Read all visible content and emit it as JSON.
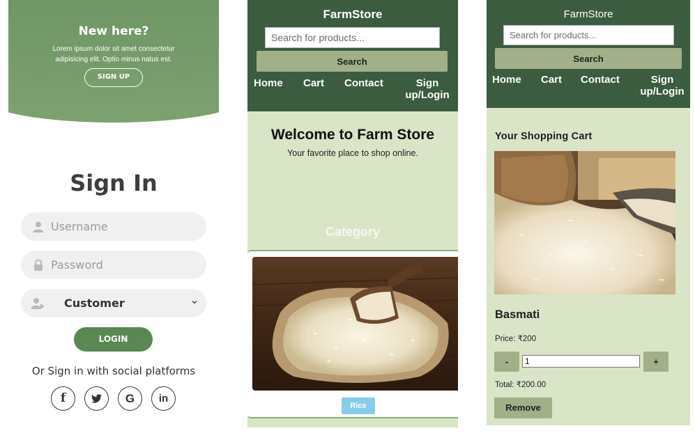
{
  "signin": {
    "banner_title": "New here?",
    "banner_text": "Lorem ipsum dolor sit amet consectetur adipisicing elit. Optio minus natus est.",
    "signup_label": "SIGN UP",
    "title": "Sign In",
    "username_placeholder": "Username",
    "password_placeholder": "Password",
    "role_value": "Customer",
    "login_label": "LOGIN",
    "social_text": "Or Sign in with social platforms",
    "social": [
      {
        "icon": "facebook-icon",
        "glyph": "f"
      },
      {
        "icon": "twitter-icon",
        "glyph": "t"
      },
      {
        "icon": "google-icon",
        "glyph": "G"
      },
      {
        "icon": "linkedin-icon",
        "glyph": "in"
      }
    ],
    "colors": {
      "primary": "#5b8753",
      "field_bg": "#f0f0f0"
    }
  },
  "store": {
    "brand": "FarmStore",
    "search_placeholder": "Search for products...",
    "search_label": "Search",
    "nav": {
      "home": "Home",
      "cart": "Cart",
      "contact": "Contact",
      "signup_line1": "Sign",
      "signup_line2": "up/Login"
    },
    "welcome": "Welcome to Farm Store",
    "tagline": "Your favorite place to shop online.",
    "category_title": "Category",
    "category_item": "Rice",
    "colors": {
      "header": "#3b5c3e",
      "page_bg": "#d9e5c6",
      "button": "#a2b08a",
      "badge": "#87ccea"
    }
  },
  "cart": {
    "brand": "FarmStore",
    "search_placeholder": "Search for products...",
    "search_label": "Search",
    "nav": {
      "home": "Home",
      "cart": "Cart",
      "contact": "Contact",
      "signup_line1": "Sign",
      "signup_line2": "up/Login"
    },
    "title": "Your Shopping Cart",
    "product_name": "Basmati",
    "price_text": "Price: ₹200",
    "minus": "-",
    "quantity": "1",
    "plus": "+",
    "total_text": "Total: ₹200.00",
    "remove_label": "Remove"
  }
}
